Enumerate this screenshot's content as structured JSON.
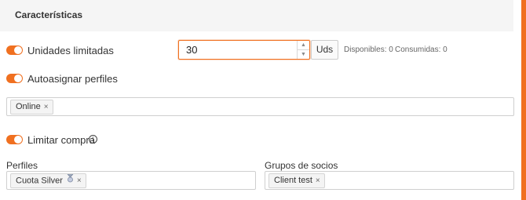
{
  "section": {
    "title": "Características"
  },
  "unidades": {
    "label": "Unidades limitadas",
    "enabled": true,
    "value": "30",
    "unit": "Uds",
    "disponibles": "Disponibles: 0",
    "consumidas": "Consumidas: 0"
  },
  "autoasignar": {
    "label": "Autoasignar perfiles",
    "enabled": true,
    "tags": [
      "Online"
    ]
  },
  "limitar": {
    "label": "Limitar compra",
    "enabled": true,
    "info_glyph": "i"
  },
  "perfiles": {
    "label": "Perfiles",
    "tags": [
      "Cuota Silver"
    ]
  },
  "grupos": {
    "label": "Grupos de socios",
    "tags": [
      "Client test"
    ]
  },
  "remove_glyph": "×",
  "spin_up": "▲",
  "spin_down": "▼",
  "colors": {
    "accent": "#f07020",
    "header_bg": "#f5f5f5",
    "border": "#cfcfcf"
  }
}
